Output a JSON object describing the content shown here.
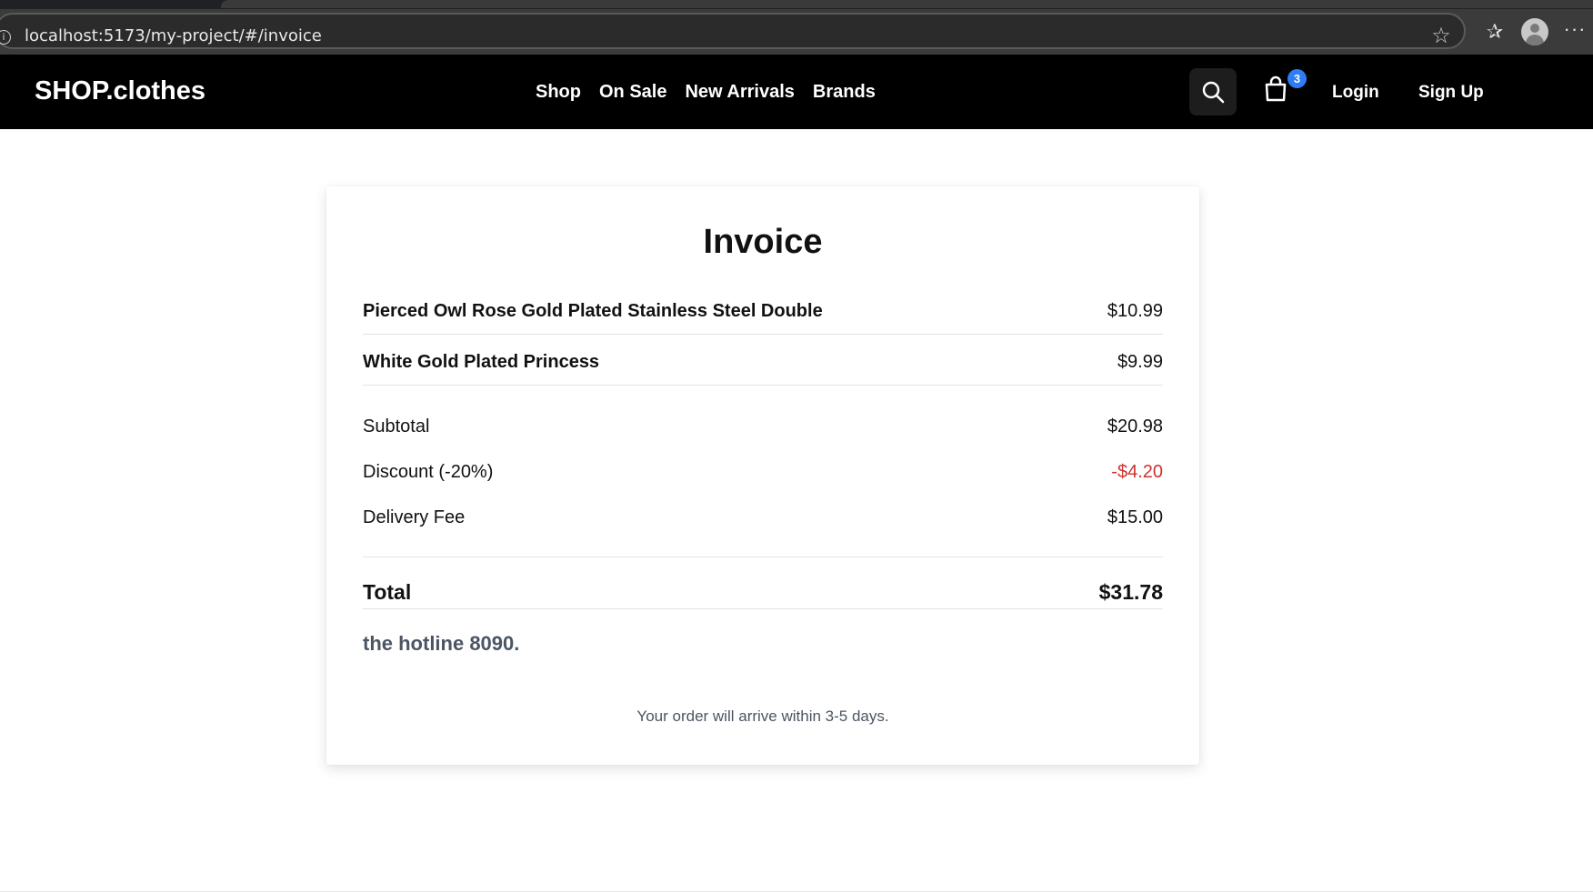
{
  "browser": {
    "url": "localhost:5173/my-project/#/invoice"
  },
  "header": {
    "logo": "SHOP.clothes",
    "nav": [
      "Shop",
      "On Sale",
      "New Arrivals",
      "Brands"
    ],
    "cart_count": "3",
    "login": "Login",
    "signup": "Sign Up"
  },
  "invoice": {
    "title": "Invoice",
    "items": [
      {
        "name": "Pierced Owl Rose Gold Plated Stainless Steel Double",
        "price": "$10.99"
      },
      {
        "name": "White Gold Plated Princess",
        "price": "$9.99"
      }
    ],
    "subtotal_label": "Subtotal",
    "subtotal_value": "$20.98",
    "discount_label": "Discount (-20%)",
    "discount_value": "-$4.20",
    "delivery_label": "Delivery Fee",
    "delivery_value": "$15.00",
    "total_label": "Total",
    "total_value": "$31.78",
    "hotline": "the hotline 8090.",
    "arrival_note": "Your order will arrive within 3-5 days."
  },
  "colors": {
    "header_bg": "#000000",
    "badge": "#2f7df6",
    "discount": "#d0312d",
    "muted_text": "#4b5563"
  }
}
